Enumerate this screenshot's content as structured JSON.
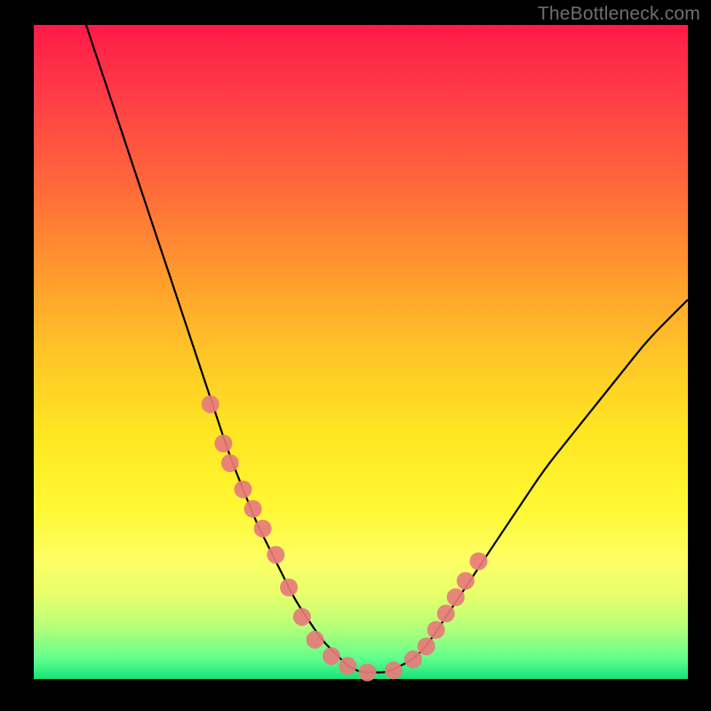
{
  "watermark": "TheBottleneck.com",
  "colors": {
    "curve": "#000000",
    "marker_fill": "#e77b7b",
    "marker_stroke": "#e77b7b"
  },
  "chart_data": {
    "type": "line",
    "title": "",
    "xlabel": "",
    "ylabel": "",
    "xlim": [
      0,
      100
    ],
    "ylim": [
      0,
      100
    ],
    "grid": false,
    "legend": false,
    "series": [
      {
        "name": "bottleneck-curve",
        "x_pct": [
          8,
          10,
          12,
          14,
          16,
          18,
          20,
          22,
          24,
          26,
          28,
          30,
          32,
          34,
          36,
          38,
          40,
          42,
          44,
          46,
          48,
          50,
          52,
          54,
          56,
          58,
          60,
          62,
          64,
          66,
          68,
          70,
          74,
          78,
          82,
          86,
          90,
          94,
          98,
          100
        ],
        "y_pct": [
          100,
          94,
          88,
          82,
          76,
          70,
          64,
          58,
          52,
          46,
          40,
          34,
          29,
          24,
          20,
          16,
          12,
          9,
          6,
          4,
          2,
          1,
          1,
          1,
          2,
          3,
          5,
          8,
          11,
          14,
          17,
          20,
          26,
          32,
          37,
          42,
          47,
          52,
          56,
          58
        ]
      }
    ],
    "markers": {
      "name": "highlighted-points",
      "x_pct": [
        27,
        29,
        30,
        32,
        33.5,
        35,
        37,
        39,
        41,
        43,
        45.5,
        48,
        51,
        55,
        58,
        60,
        61.5,
        63,
        64.5,
        66,
        68
      ],
      "y_pct": [
        42,
        36,
        33,
        29,
        26,
        23,
        19,
        14,
        9.5,
        6,
        3.5,
        2,
        1,
        1.3,
        3,
        5,
        7.5,
        10,
        12.5,
        15,
        18
      ]
    }
  }
}
